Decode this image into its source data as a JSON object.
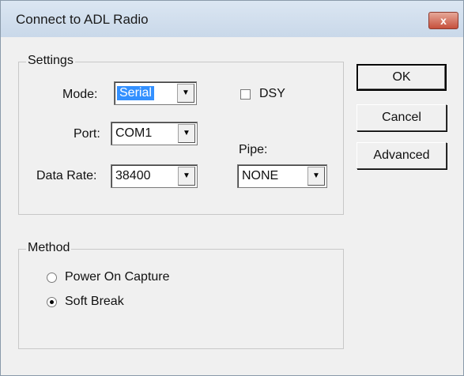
{
  "window": {
    "title": "Connect to ADL Radio",
    "close_label": "x"
  },
  "settings": {
    "legend": "Settings",
    "mode": {
      "label": "Mode:",
      "value": "Serial"
    },
    "port": {
      "label": "Port:",
      "value": "COM1"
    },
    "data_rate": {
      "label": "Data Rate:",
      "value": "38400"
    },
    "dsy": {
      "label": "DSY",
      "checked": false
    },
    "pipe": {
      "label": "Pipe:",
      "value": "NONE"
    }
  },
  "method": {
    "legend": "Method",
    "options": [
      {
        "label": "Power On Capture",
        "selected": false
      },
      {
        "label": "Soft Break",
        "selected": true
      }
    ]
  },
  "buttons": {
    "ok": "OK",
    "cancel": "Cancel",
    "advanced": "Advanced"
  },
  "icons": {
    "dropdown": "chevron-down-icon",
    "close": "close-icon"
  }
}
